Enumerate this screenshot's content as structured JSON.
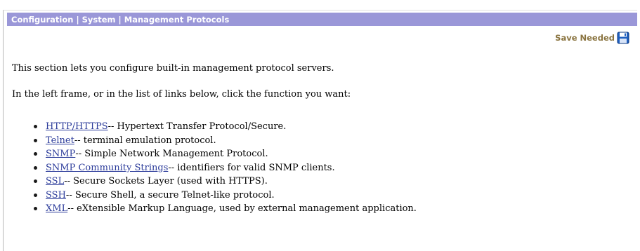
{
  "header": {
    "breadcrumb": [
      "Configuration",
      "System",
      "Management Protocols"
    ],
    "separator": "|"
  },
  "toolbar": {
    "save_label": "Save Needed",
    "save_icon": "floppy-disk-icon",
    "accent_color": "#9a97d8"
  },
  "content": {
    "intro_1": "This section lets you configure built-in management protocol servers.",
    "intro_2": "In the left frame, or in the list of links below, click the function you want:",
    "links": [
      {
        "label": "HTTP/HTTPS",
        "desc": " -- Hypertext Transfer Protocol/Secure."
      },
      {
        "label": "Telnet",
        "desc": " -- terminal emulation protocol."
      },
      {
        "label": "SNMP",
        "desc": " -- Simple Network Management Protocol."
      },
      {
        "label": "SNMP Community Strings",
        "desc": " -- identifiers for valid SNMP clients."
      },
      {
        "label": "SSL",
        "desc": " -- Secure Sockets Layer (used with HTTPS)."
      },
      {
        "label": "SSH",
        "desc": " -- Secure Shell, a secure Telnet-like protocol."
      },
      {
        "label": "XML",
        "desc": " -- eXtensible Markup Language, used by external management application."
      }
    ]
  }
}
